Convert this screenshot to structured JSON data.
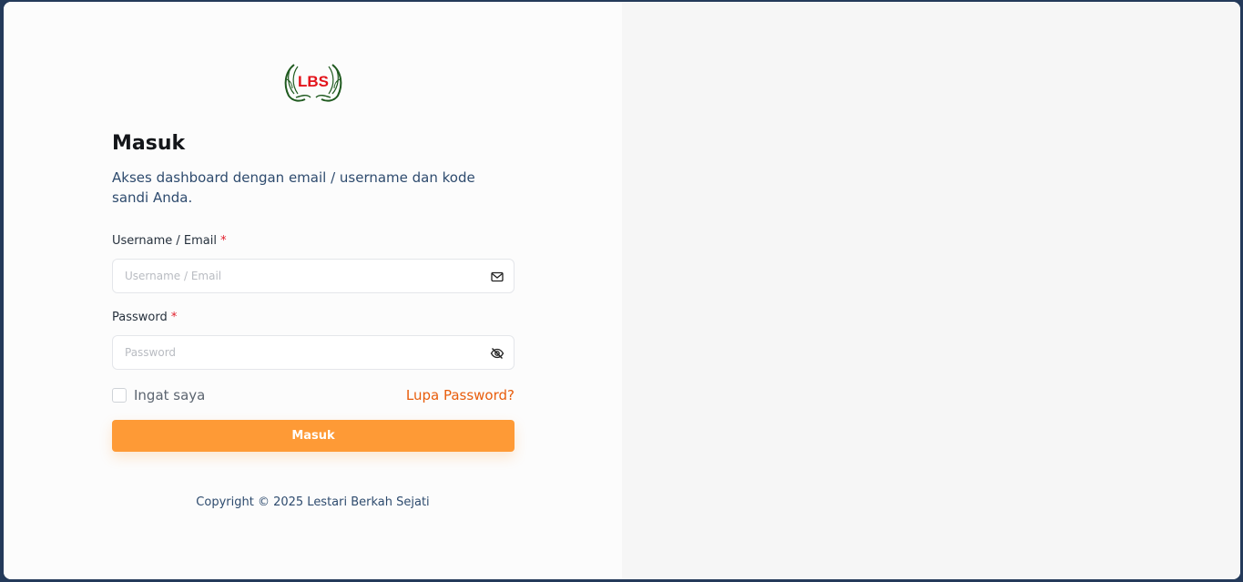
{
  "login": {
    "title": "Masuk",
    "subtitle": "Akses dashboard dengan email / username dan kode sandi Anda.",
    "username_label": "Username / Email",
    "username_placeholder": "Username / Email",
    "password_label": "Password",
    "password_placeholder": "Password",
    "required_mark": "*",
    "remember_label": "Ingat saya",
    "forgot_label": "Lupa Password?",
    "submit_label": "Masuk"
  },
  "footer": {
    "copyright": "Copyright © 2025 Lestari Berkah Sejati"
  },
  "logo": {
    "text": "LBS"
  },
  "icons": {
    "username_field": "mail-icon",
    "password_field": "eye-off-icon"
  },
  "colors": {
    "accent": "#fe9a36",
    "link": "#e85d0c",
    "required": "#e11d2a",
    "logo_red": "#e3131b",
    "logo_green": "#1f5a1f"
  }
}
